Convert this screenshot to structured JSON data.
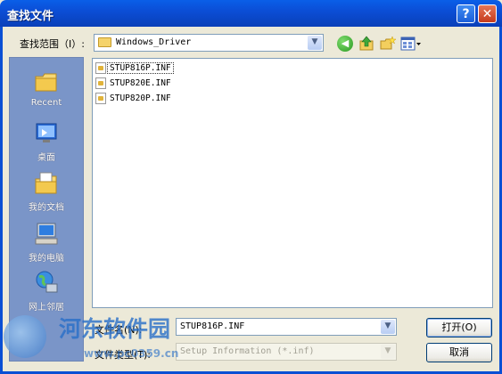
{
  "window": {
    "title": "查找文件",
    "help_glyph": "?",
    "close_glyph": "✕"
  },
  "lookin": {
    "label": "查找范围（I）:",
    "value": "Windows_Driver",
    "dropdown_glyph": "▼"
  },
  "toolbar": {
    "back_glyph": "◀",
    "icons": [
      "back-icon",
      "up-folder-icon",
      "new-folder-icon",
      "views-menu-icon"
    ]
  },
  "places": [
    {
      "label": "Recent",
      "icon": "recent-folder-icon"
    },
    {
      "label": "桌面",
      "icon": "desktop-icon"
    },
    {
      "label": "我的文档",
      "icon": "my-documents-icon"
    },
    {
      "label": "我的电脑",
      "icon": "my-computer-icon"
    },
    {
      "label": "网上邻居",
      "icon": "network-places-icon"
    }
  ],
  "files": [
    {
      "name": "STUP816P.INF",
      "selected": true
    },
    {
      "name": "STUP820E.INF",
      "selected": false
    },
    {
      "name": "STUP820P.INF",
      "selected": false
    }
  ],
  "filename": {
    "label": "文件名(N):",
    "value": "STUP816P.INF",
    "dropdown_glyph": "▼"
  },
  "filetype": {
    "label": "文件类型(T):",
    "value": "Setup Information (*.inf)",
    "dropdown_glyph": "▼"
  },
  "buttons": {
    "open": "打开(O)",
    "cancel": "取消"
  },
  "watermark": {
    "text": "河东软件园",
    "url": "www.pc0359.cn"
  },
  "colors": {
    "titlebar": "#0a4fd4",
    "places_bar": "#7a95c8",
    "dialog_bg": "#ece9d8"
  }
}
